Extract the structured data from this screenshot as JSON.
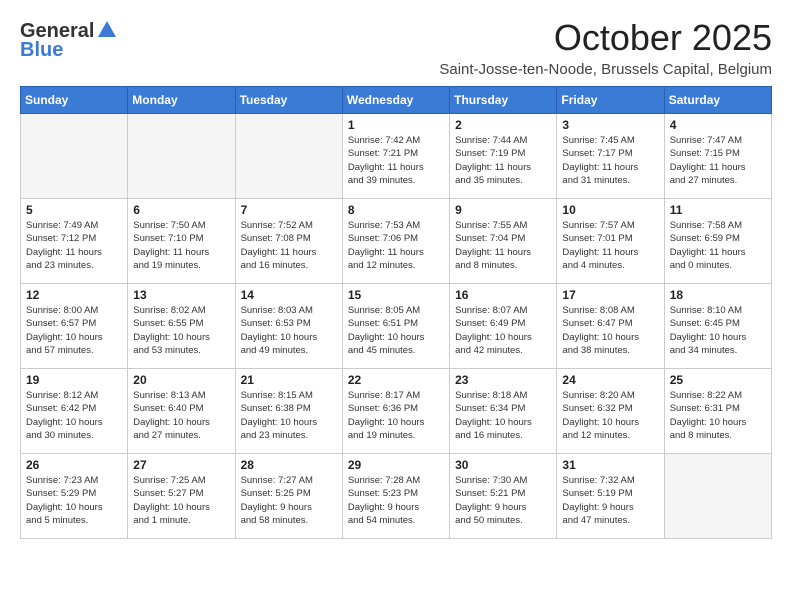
{
  "header": {
    "logo_general": "General",
    "logo_blue": "Blue",
    "month_title": "October 2025",
    "location": "Saint-Josse-ten-Noode, Brussels Capital, Belgium"
  },
  "days_of_week": [
    "Sunday",
    "Monday",
    "Tuesday",
    "Wednesday",
    "Thursday",
    "Friday",
    "Saturday"
  ],
  "weeks": [
    [
      {
        "day": "",
        "info": ""
      },
      {
        "day": "",
        "info": ""
      },
      {
        "day": "",
        "info": ""
      },
      {
        "day": "1",
        "info": "Sunrise: 7:42 AM\nSunset: 7:21 PM\nDaylight: 11 hours\nand 39 minutes."
      },
      {
        "day": "2",
        "info": "Sunrise: 7:44 AM\nSunset: 7:19 PM\nDaylight: 11 hours\nand 35 minutes."
      },
      {
        "day": "3",
        "info": "Sunrise: 7:45 AM\nSunset: 7:17 PM\nDaylight: 11 hours\nand 31 minutes."
      },
      {
        "day": "4",
        "info": "Sunrise: 7:47 AM\nSunset: 7:15 PM\nDaylight: 11 hours\nand 27 minutes."
      }
    ],
    [
      {
        "day": "5",
        "info": "Sunrise: 7:49 AM\nSunset: 7:12 PM\nDaylight: 11 hours\nand 23 minutes."
      },
      {
        "day": "6",
        "info": "Sunrise: 7:50 AM\nSunset: 7:10 PM\nDaylight: 11 hours\nand 19 minutes."
      },
      {
        "day": "7",
        "info": "Sunrise: 7:52 AM\nSunset: 7:08 PM\nDaylight: 11 hours\nand 16 minutes."
      },
      {
        "day": "8",
        "info": "Sunrise: 7:53 AM\nSunset: 7:06 PM\nDaylight: 11 hours\nand 12 minutes."
      },
      {
        "day": "9",
        "info": "Sunrise: 7:55 AM\nSunset: 7:04 PM\nDaylight: 11 hours\nand 8 minutes."
      },
      {
        "day": "10",
        "info": "Sunrise: 7:57 AM\nSunset: 7:01 PM\nDaylight: 11 hours\nand 4 minutes."
      },
      {
        "day": "11",
        "info": "Sunrise: 7:58 AM\nSunset: 6:59 PM\nDaylight: 11 hours\nand 0 minutes."
      }
    ],
    [
      {
        "day": "12",
        "info": "Sunrise: 8:00 AM\nSunset: 6:57 PM\nDaylight: 10 hours\nand 57 minutes."
      },
      {
        "day": "13",
        "info": "Sunrise: 8:02 AM\nSunset: 6:55 PM\nDaylight: 10 hours\nand 53 minutes."
      },
      {
        "day": "14",
        "info": "Sunrise: 8:03 AM\nSunset: 6:53 PM\nDaylight: 10 hours\nand 49 minutes."
      },
      {
        "day": "15",
        "info": "Sunrise: 8:05 AM\nSunset: 6:51 PM\nDaylight: 10 hours\nand 45 minutes."
      },
      {
        "day": "16",
        "info": "Sunrise: 8:07 AM\nSunset: 6:49 PM\nDaylight: 10 hours\nand 42 minutes."
      },
      {
        "day": "17",
        "info": "Sunrise: 8:08 AM\nSunset: 6:47 PM\nDaylight: 10 hours\nand 38 minutes."
      },
      {
        "day": "18",
        "info": "Sunrise: 8:10 AM\nSunset: 6:45 PM\nDaylight: 10 hours\nand 34 minutes."
      }
    ],
    [
      {
        "day": "19",
        "info": "Sunrise: 8:12 AM\nSunset: 6:42 PM\nDaylight: 10 hours\nand 30 minutes."
      },
      {
        "day": "20",
        "info": "Sunrise: 8:13 AM\nSunset: 6:40 PM\nDaylight: 10 hours\nand 27 minutes."
      },
      {
        "day": "21",
        "info": "Sunrise: 8:15 AM\nSunset: 6:38 PM\nDaylight: 10 hours\nand 23 minutes."
      },
      {
        "day": "22",
        "info": "Sunrise: 8:17 AM\nSunset: 6:36 PM\nDaylight: 10 hours\nand 19 minutes."
      },
      {
        "day": "23",
        "info": "Sunrise: 8:18 AM\nSunset: 6:34 PM\nDaylight: 10 hours\nand 16 minutes."
      },
      {
        "day": "24",
        "info": "Sunrise: 8:20 AM\nSunset: 6:32 PM\nDaylight: 10 hours\nand 12 minutes."
      },
      {
        "day": "25",
        "info": "Sunrise: 8:22 AM\nSunset: 6:31 PM\nDaylight: 10 hours\nand 8 minutes."
      }
    ],
    [
      {
        "day": "26",
        "info": "Sunrise: 7:23 AM\nSunset: 5:29 PM\nDaylight: 10 hours\nand 5 minutes."
      },
      {
        "day": "27",
        "info": "Sunrise: 7:25 AM\nSunset: 5:27 PM\nDaylight: 10 hours\nand 1 minute."
      },
      {
        "day": "28",
        "info": "Sunrise: 7:27 AM\nSunset: 5:25 PM\nDaylight: 9 hours\nand 58 minutes."
      },
      {
        "day": "29",
        "info": "Sunrise: 7:28 AM\nSunset: 5:23 PM\nDaylight: 9 hours\nand 54 minutes."
      },
      {
        "day": "30",
        "info": "Sunrise: 7:30 AM\nSunset: 5:21 PM\nDaylight: 9 hours\nand 50 minutes."
      },
      {
        "day": "31",
        "info": "Sunrise: 7:32 AM\nSunset: 5:19 PM\nDaylight: 9 hours\nand 47 minutes."
      },
      {
        "day": "",
        "info": ""
      }
    ]
  ]
}
